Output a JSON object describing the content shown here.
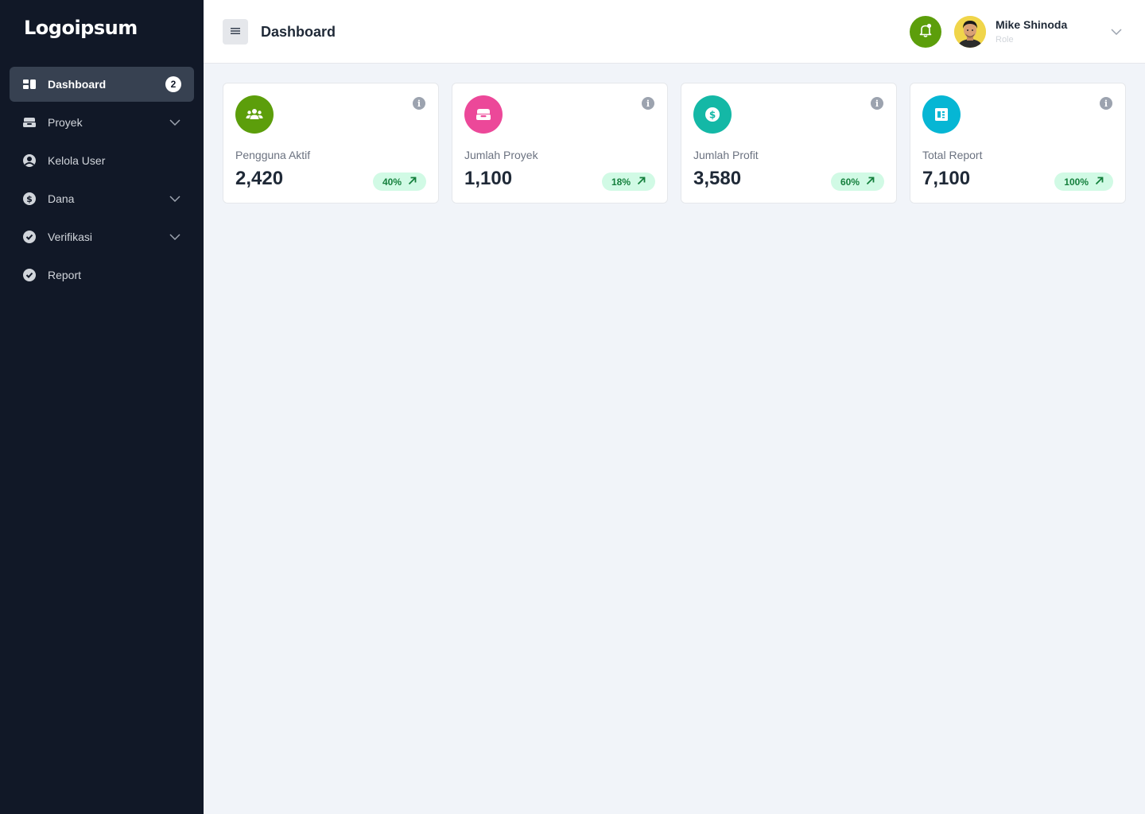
{
  "app": {
    "logo_text": "Logoipsum"
  },
  "sidebar": {
    "items": [
      {
        "label": "Dashboard",
        "icon": "dashboard-icon",
        "badge": "2",
        "active": true
      },
      {
        "label": "Proyek",
        "icon": "inbox-icon",
        "has_chevron": true
      },
      {
        "label": "Kelola User",
        "icon": "user-circle-icon"
      },
      {
        "label": "Dana",
        "icon": "dollar-circle-icon",
        "has_chevron": true
      },
      {
        "label": "Verifikasi",
        "icon": "check-circle-icon",
        "has_chevron": true
      },
      {
        "label": "Report",
        "icon": "check-circle-icon"
      }
    ]
  },
  "header": {
    "title": "Dashboard",
    "user": {
      "name": "Mike Shinoda",
      "role": "Role"
    }
  },
  "cards": [
    {
      "label": "Pengguna Aktif",
      "value": "2,420",
      "badge": "40%",
      "icon": "users-icon",
      "color": "#5c9e0b"
    },
    {
      "label": "Jumlah Proyek",
      "value": "1,100",
      "badge": "18%",
      "icon": "inbox-icon",
      "color": "#ec4899"
    },
    {
      "label": "Jumlah Profit",
      "value": "3,580",
      "badge": "60%",
      "icon": "dollar-icon",
      "color": "#14b8a6"
    },
    {
      "label": "Total Report",
      "value": "7,100",
      "badge": "100%",
      "icon": "report-icon",
      "color": "#06b6d4"
    }
  ],
  "colors": {
    "sidebar_bg": "#111827",
    "active_item_bg": "#374151",
    "badge_bg": "#d1fae5",
    "badge_text": "#15803d"
  }
}
